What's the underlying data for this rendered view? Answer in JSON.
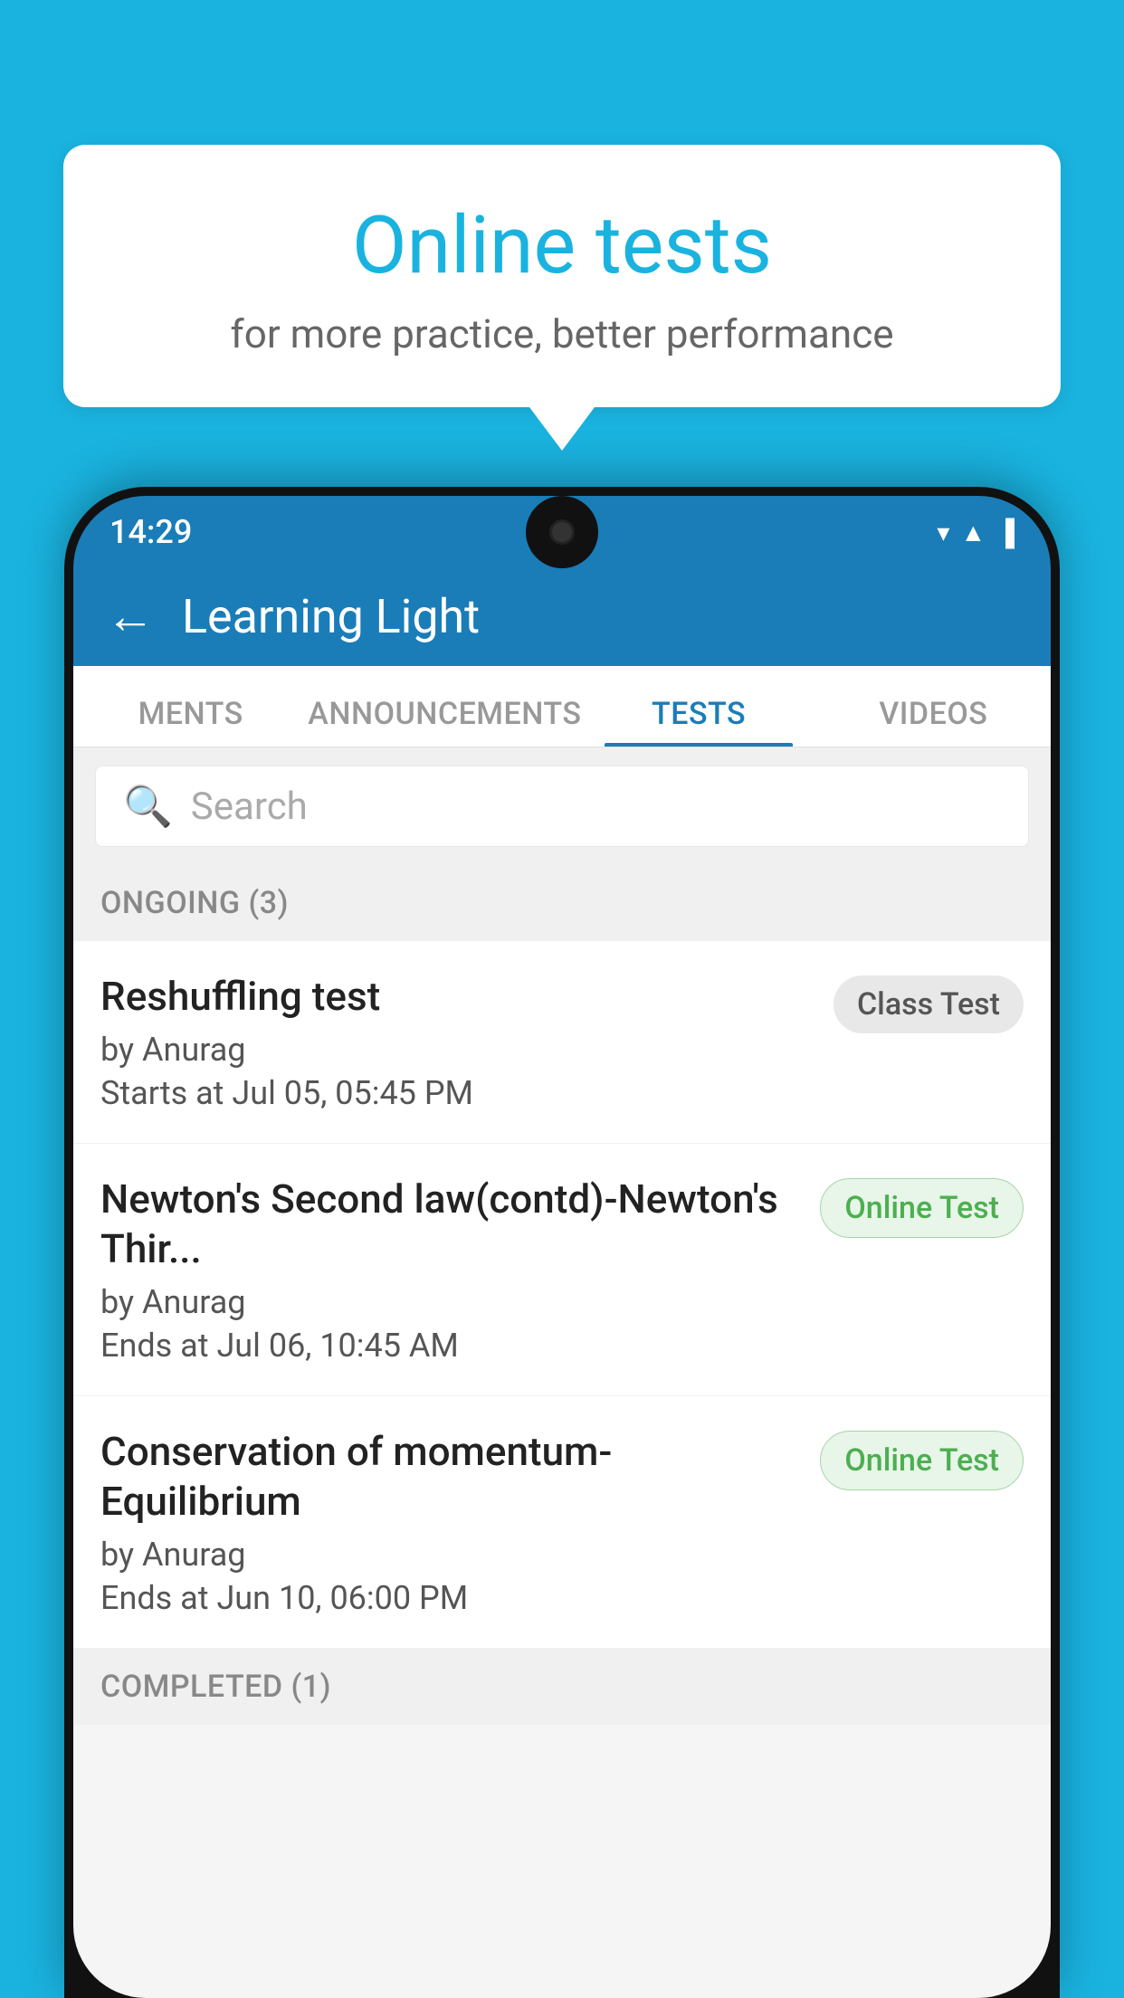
{
  "background_color": "#1ab3e0",
  "bubble": {
    "title": "Online tests",
    "subtitle": "for more practice, better performance"
  },
  "phone": {
    "time": "14:29",
    "header": {
      "back_label": "←",
      "app_name": "Learning Light"
    },
    "tabs": [
      {
        "label": "MENTS",
        "active": false
      },
      {
        "label": "ANNOUNCEMENTS",
        "active": false
      },
      {
        "label": "TESTS",
        "active": true
      },
      {
        "label": "VIDEOS",
        "active": false
      }
    ],
    "search": {
      "placeholder": "Search"
    },
    "ongoing_section": "ONGOING (3)",
    "tests": [
      {
        "name": "Reshuffling test",
        "author": "by Anurag",
        "date": "Starts at  Jul 05, 05:45 PM",
        "badge": "Class Test",
        "badge_type": "class"
      },
      {
        "name": "Newton's Second law(contd)-Newton's Thir...",
        "author": "by Anurag",
        "date": "Ends at  Jul 06, 10:45 AM",
        "badge": "Online Test",
        "badge_type": "online"
      },
      {
        "name": "Conservation of momentum-Equilibrium",
        "author": "by Anurag",
        "date": "Ends at  Jun 10, 06:00 PM",
        "badge": "Online Test",
        "badge_type": "online"
      }
    ],
    "completed_section": "COMPLETED (1)"
  }
}
